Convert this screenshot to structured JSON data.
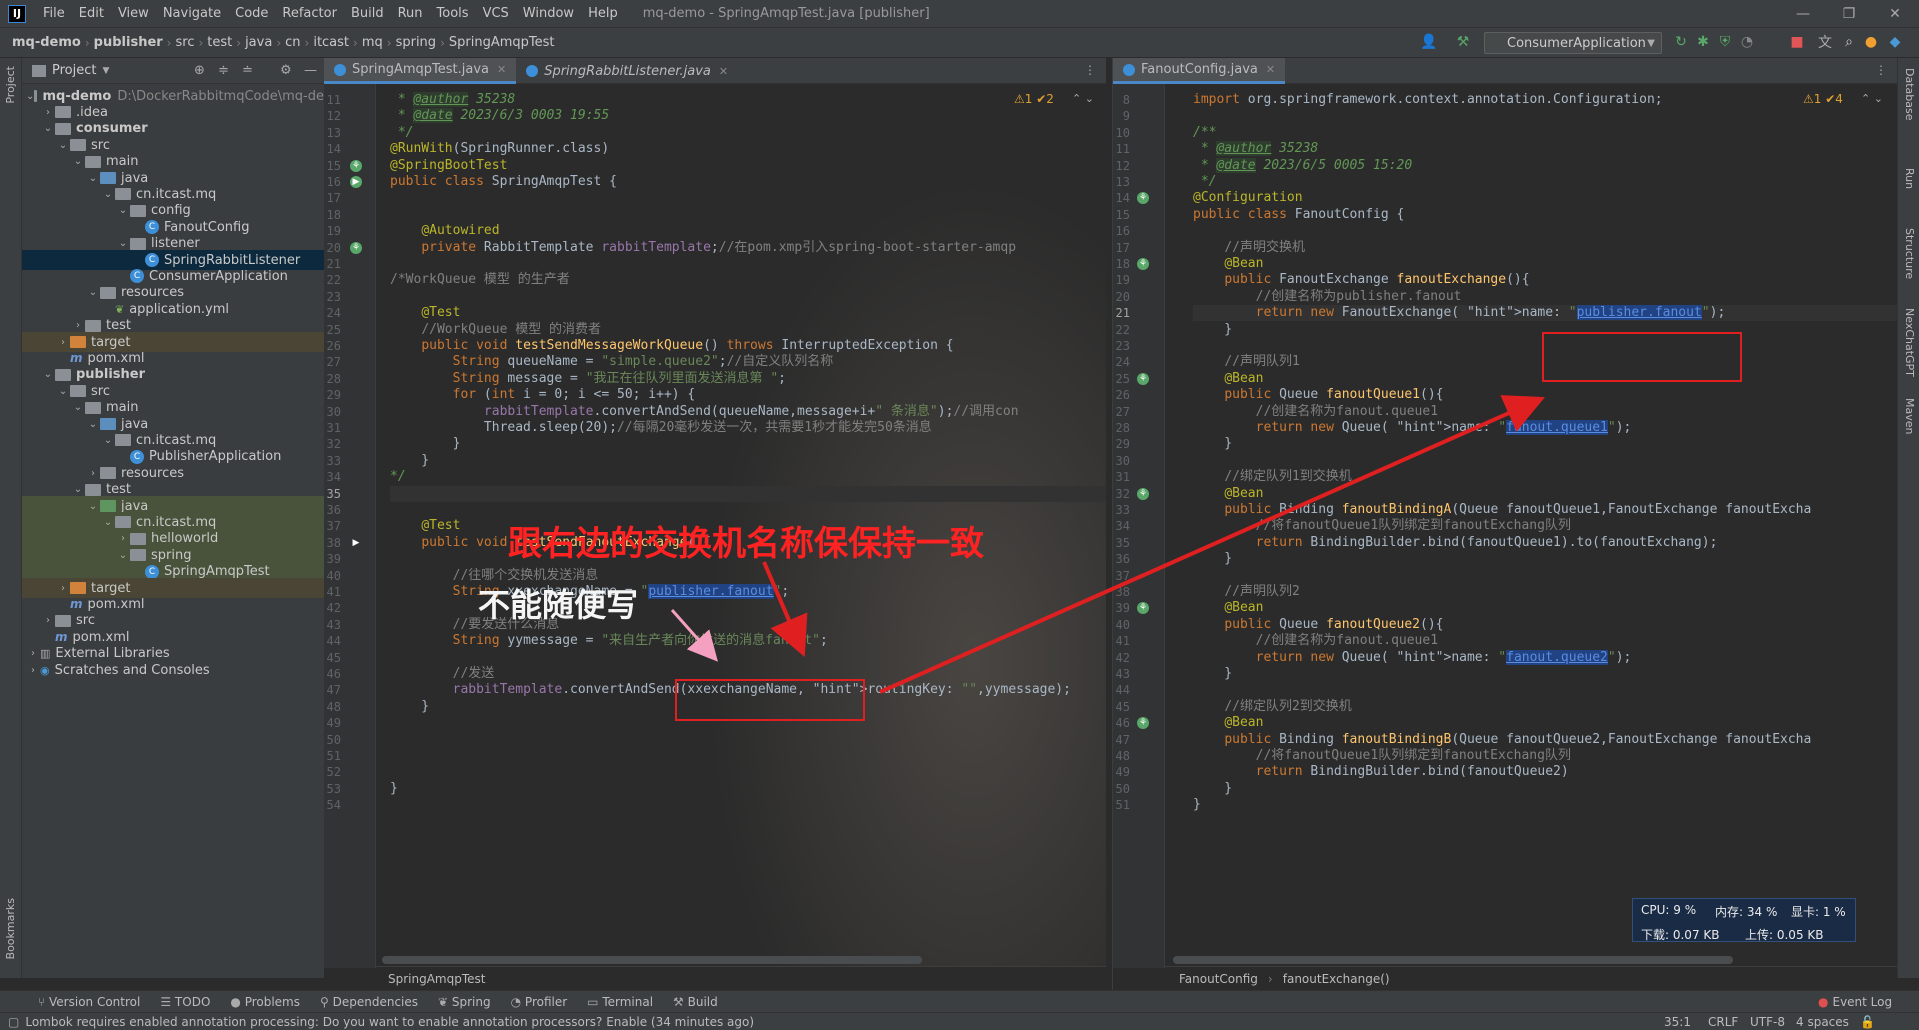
{
  "menubar": {
    "logo": "IJ",
    "items": [
      "File",
      "Edit",
      "View",
      "Navigate",
      "Code",
      "Refactor",
      "Build",
      "Run",
      "Tools",
      "VCS",
      "Window",
      "Help"
    ],
    "title": "mq-demo - SpringAmqpTest.java [publisher]"
  },
  "breadcrumbs": [
    "mq-demo",
    "publisher",
    "src",
    "test",
    "java",
    "cn",
    "itcast",
    "mq",
    "spring",
    "SpringAmqpTest"
  ],
  "run_config": "ConsumerApplication",
  "left_strip": {
    "project": "Project",
    "bookmarks": "Bookmarks"
  },
  "right_strip": {
    "database": "Database",
    "run": "Run",
    "structure": "Structure",
    "nexchatgpt": "NexChatGPT",
    "maven": "Maven"
  },
  "project_panel": {
    "title": "Project"
  },
  "tree": [
    {
      "label": "mq-demo",
      "extra": "D:\\DockerRabbitmqCode\\mq-de",
      "depth": 0,
      "icon": "folder-grey",
      "arrow": "down",
      "bold": true
    },
    {
      "label": ".idea",
      "depth": 1,
      "icon": "folder-grey",
      "arrow": "right"
    },
    {
      "label": "consumer",
      "depth": 1,
      "icon": "folder-grey",
      "arrow": "down",
      "bold": true
    },
    {
      "label": "src",
      "depth": 2,
      "icon": "folder-grey",
      "arrow": "down"
    },
    {
      "label": "main",
      "depth": 3,
      "icon": "folder-grey",
      "arrow": "down"
    },
    {
      "label": "java",
      "depth": 4,
      "icon": "folder-blue",
      "arrow": "down"
    },
    {
      "label": "cn.itcast.mq",
      "depth": 5,
      "icon": "folder-grey",
      "arrow": "down"
    },
    {
      "label": "config",
      "depth": 6,
      "icon": "folder-grey",
      "arrow": "down"
    },
    {
      "label": "FanoutConfig",
      "depth": 7,
      "icon": "class"
    },
    {
      "label": "listener",
      "depth": 6,
      "icon": "folder-grey",
      "arrow": "down"
    },
    {
      "label": "SpringRabbitListener",
      "depth": 7,
      "icon": "class",
      "selected": true
    },
    {
      "label": "ConsumerApplication",
      "depth": 6,
      "icon": "class"
    },
    {
      "label": "resources",
      "depth": 4,
      "icon": "folder-grey",
      "arrow": "down"
    },
    {
      "label": "application.yml",
      "depth": 5,
      "icon": "yml"
    },
    {
      "label": "test",
      "depth": 3,
      "icon": "folder-grey",
      "arrow": "right"
    },
    {
      "label": "target",
      "depth": 2,
      "icon": "folder-orange",
      "arrow": "right",
      "target": true
    },
    {
      "label": "pom.xml",
      "depth": 2,
      "icon": "maven"
    },
    {
      "label": "publisher",
      "depth": 1,
      "icon": "folder-grey",
      "arrow": "down",
      "bold": true
    },
    {
      "label": "src",
      "depth": 2,
      "icon": "folder-grey",
      "arrow": "down"
    },
    {
      "label": "main",
      "depth": 3,
      "icon": "folder-grey",
      "arrow": "down"
    },
    {
      "label": "java",
      "depth": 4,
      "icon": "folder-blue",
      "arrow": "down"
    },
    {
      "label": "cn.itcast.mq",
      "depth": 5,
      "icon": "folder-grey",
      "arrow": "down"
    },
    {
      "label": "PublisherApplication",
      "depth": 6,
      "icon": "class"
    },
    {
      "label": "resources",
      "depth": 4,
      "icon": "folder-grey",
      "arrow": "right"
    },
    {
      "label": "test",
      "depth": 3,
      "icon": "folder-grey",
      "arrow": "down"
    },
    {
      "label": "java",
      "depth": 4,
      "icon": "folder-green",
      "arrow": "down",
      "test": true
    },
    {
      "label": "cn.itcast.mq",
      "depth": 5,
      "icon": "folder-grey",
      "arrow": "down",
      "test": true
    },
    {
      "label": "helloworld",
      "depth": 6,
      "icon": "folder-grey",
      "arrow": "right",
      "test": true
    },
    {
      "label": "spring",
      "depth": 6,
      "icon": "folder-grey",
      "arrow": "down",
      "test": true
    },
    {
      "label": "SpringAmqpTest",
      "depth": 7,
      "icon": "class",
      "test": true
    },
    {
      "label": "target",
      "depth": 2,
      "icon": "folder-orange",
      "arrow": "right",
      "target": true
    },
    {
      "label": "pom.xml",
      "depth": 2,
      "icon": "maven"
    },
    {
      "label": "src",
      "depth": 1,
      "icon": "folder-grey",
      "arrow": "right"
    },
    {
      "label": "pom.xml",
      "depth": 1,
      "icon": "maven"
    },
    {
      "label": "External Libraries",
      "depth": 0,
      "icon": "libs",
      "arrow": "right"
    },
    {
      "label": "Scratches and Consoles",
      "depth": 0,
      "icon": "scratch",
      "arrow": "right"
    }
  ],
  "left_editor": {
    "tabs": [
      "SpringAmqpTest.java",
      "SpringRabbitListener.java"
    ],
    "inspection": "⚠1 ✔2",
    "breadcrumb": "SpringAmqpTest",
    "current_line": "35",
    "lines": [
      {
        "n": "11",
        "t": " * @author 35238"
      },
      {
        "n": "12",
        "t": " * @date 2023/6/3 0003 19:55"
      },
      {
        "n": "13",
        "t": " */"
      },
      {
        "n": "14",
        "t": "@RunWith(SpringRunner.class)"
      },
      {
        "n": "15",
        "t": "@SpringBootTest"
      },
      {
        "n": "16",
        "t": "public class SpringAmqpTest {"
      },
      {
        "n": "17",
        "t": ""
      },
      {
        "n": "18",
        "t": ""
      },
      {
        "n": "19",
        "t": "    @Autowired"
      },
      {
        "n": "20",
        "t": "    private RabbitTemplate rabbitTemplate;//在pom.xmp引入spring-boot-starter-amqp"
      },
      {
        "n": "21",
        "t": ""
      },
      {
        "n": "22",
        "t": "/*WorkQueue 模型 的生产者"
      },
      {
        "n": "23",
        "t": ""
      },
      {
        "n": "24",
        "t": "    @Test"
      },
      {
        "n": "25",
        "t": "    //WorkQueue 模型 的消费者"
      },
      {
        "n": "26",
        "t": "    public void testSendMessageWorkQueue() throws InterruptedException {"
      },
      {
        "n": "27",
        "t": "        String queueName = \"simple.queue2\";//自定义队列名称"
      },
      {
        "n": "28",
        "t": "        String message = \"我正在往队列里面发送消息第 \";"
      },
      {
        "n": "29",
        "t": "        for (int i = 0; i <= 50; i++) {"
      },
      {
        "n": "30",
        "t": "            rabbitTemplate.convertAndSend(queueName,message+i+\" 条消息\");//调用con"
      },
      {
        "n": "31",
        "t": "            Thread.sleep(20);//每隔20毫秒发送一次，共需要1秒才能发完50条消息"
      },
      {
        "n": "32",
        "t": "        }"
      },
      {
        "n": "33",
        "t": "    }"
      },
      {
        "n": "34",
        "t": "*/"
      },
      {
        "n": "35",
        "t": ""
      },
      {
        "n": "36",
        "t": ""
      },
      {
        "n": "37",
        "t": "    @Test"
      },
      {
        "n": "38",
        "t": "    public void testSendFanoutExchange(){"
      },
      {
        "n": "39",
        "t": ""
      },
      {
        "n": "40",
        "t": "        //往哪个交换机发送消息"
      },
      {
        "n": "41",
        "t": "        String xxexchangeName = \"publisher.fanout\";"
      },
      {
        "n": "42",
        "t": ""
      },
      {
        "n": "43",
        "t": "        //要发送什么消息"
      },
      {
        "n": "44",
        "t": "        String yymessage = \"来自生产者向你发送的消息fanout\";"
      },
      {
        "n": "45",
        "t": ""
      },
      {
        "n": "46",
        "t": "        //发送"
      },
      {
        "n": "47",
        "t": "        rabbitTemplate.convertAndSend(xxexchangeName, routingKey: \"\",yymessage);"
      },
      {
        "n": "48",
        "t": "    }"
      },
      {
        "n": "49",
        "t": ""
      },
      {
        "n": "50",
        "t": ""
      },
      {
        "n": "51",
        "t": ""
      },
      {
        "n": "52",
        "t": ""
      },
      {
        "n": "53",
        "t": "}"
      },
      {
        "n": "54",
        "t": ""
      }
    ]
  },
  "right_editor": {
    "tabs": [
      "FanoutConfig.java"
    ],
    "inspection": "⚠1 ✔4",
    "breadcrumb": [
      "FanoutConfig",
      "fanoutExchange()"
    ],
    "current_line": "21",
    "lines": [
      {
        "n": "8",
        "t": "import org.springframework.context.annotation.Configuration;"
      },
      {
        "n": "9",
        "t": ""
      },
      {
        "n": "10",
        "t": "/**"
      },
      {
        "n": "11",
        "t": " * @author 35238"
      },
      {
        "n": "12",
        "t": " * @date 2023/6/5 0005 15:20"
      },
      {
        "n": "13",
        "t": " */"
      },
      {
        "n": "14",
        "t": "@Configuration"
      },
      {
        "n": "15",
        "t": "public class FanoutConfig {"
      },
      {
        "n": "16",
        "t": ""
      },
      {
        "n": "17",
        "t": "    //声明交换机"
      },
      {
        "n": "18",
        "t": "    @Bean"
      },
      {
        "n": "19",
        "t": "    public FanoutExchange fanoutExchange(){"
      },
      {
        "n": "20",
        "t": "        //创建名称为publisher.fanout"
      },
      {
        "n": "21",
        "t": "        return new FanoutExchange( name: \"publisher.fanout\");"
      },
      {
        "n": "22",
        "t": "    }"
      },
      {
        "n": "23",
        "t": ""
      },
      {
        "n": "24",
        "t": "    //声明队列1"
      },
      {
        "n": "25",
        "t": "    @Bean"
      },
      {
        "n": "26",
        "t": "    public Queue fanoutQueue1(){"
      },
      {
        "n": "27",
        "t": "        //创建名称为fanout.queue1"
      },
      {
        "n": "28",
        "t": "        return new Queue( name: \"fanout.queue1\");"
      },
      {
        "n": "29",
        "t": "    }"
      },
      {
        "n": "30",
        "t": ""
      },
      {
        "n": "31",
        "t": "    //绑定队列1到交换机"
      },
      {
        "n": "32",
        "t": "    @Bean"
      },
      {
        "n": "33",
        "t": "    public Binding fanoutBindingA(Queue fanoutQueue1,FanoutExchange fanoutExcha"
      },
      {
        "n": "34",
        "t": "        //将fanoutQueue1队列绑定到fanoutExchang队列"
      },
      {
        "n": "35",
        "t": "        return BindingBuilder.bind(fanoutQueue1).to(fanoutExchang);"
      },
      {
        "n": "36",
        "t": "    }"
      },
      {
        "n": "37",
        "t": ""
      },
      {
        "n": "38",
        "t": "    //声明队列2"
      },
      {
        "n": "39",
        "t": "    @Bean"
      },
      {
        "n": "40",
        "t": "    public Queue fanoutQueue2(){"
      },
      {
        "n": "41",
        "t": "        //创建名称为fanout.queue1"
      },
      {
        "n": "42",
        "t": "        return new Queue( name: \"fanout.queue2\");"
      },
      {
        "n": "43",
        "t": "    }"
      },
      {
        "n": "44",
        "t": ""
      },
      {
        "n": "45",
        "t": "    //绑定队列2到交换机"
      },
      {
        "n": "46",
        "t": "    @Bean"
      },
      {
        "n": "47",
        "t": "    public Binding fanoutBindingB(Queue fanoutQueue2,FanoutExchange fanoutExcha"
      },
      {
        "n": "48",
        "t": "        //将fanoutQueue1队列绑定到fanoutExchang队列"
      },
      {
        "n": "49",
        "t": "        return BindingBuilder.bind(fanoutQueue2)"
      },
      {
        "n": "50",
        "t": "    }"
      },
      {
        "n": "51",
        "t": "}"
      }
    ]
  },
  "annotations": {
    "main": "跟右边的交换机名称保保持一致",
    "sub": "不能随便写"
  },
  "perf": {
    "cpu": "CPU: 9 %",
    "mem": "内存: 34 %",
    "gpu": "显卡: 1 %",
    "down": "下载: 0.07 KB",
    "up": "上传: 0.05 KB"
  },
  "bottom_tools": [
    "Version Control",
    "TODO",
    "Problems",
    "Dependencies",
    "Spring",
    "Profiler",
    "Terminal",
    "Build"
  ],
  "event_log": "Event Log",
  "status": {
    "message": "Lombok requires enabled annotation processing: Do you want to enable annotation processors? Enable (34 minutes ago)",
    "position": "35:1",
    "line_sep": "CRLF",
    "encoding": "UTF-8",
    "indent": "4 spaces"
  },
  "colors": {
    "keyword": "#cc7832",
    "annotation": "#bbb529",
    "string": "#6a8759",
    "comment": "#808080",
    "method": "#ffc66d",
    "annot_red": "#e02020"
  }
}
